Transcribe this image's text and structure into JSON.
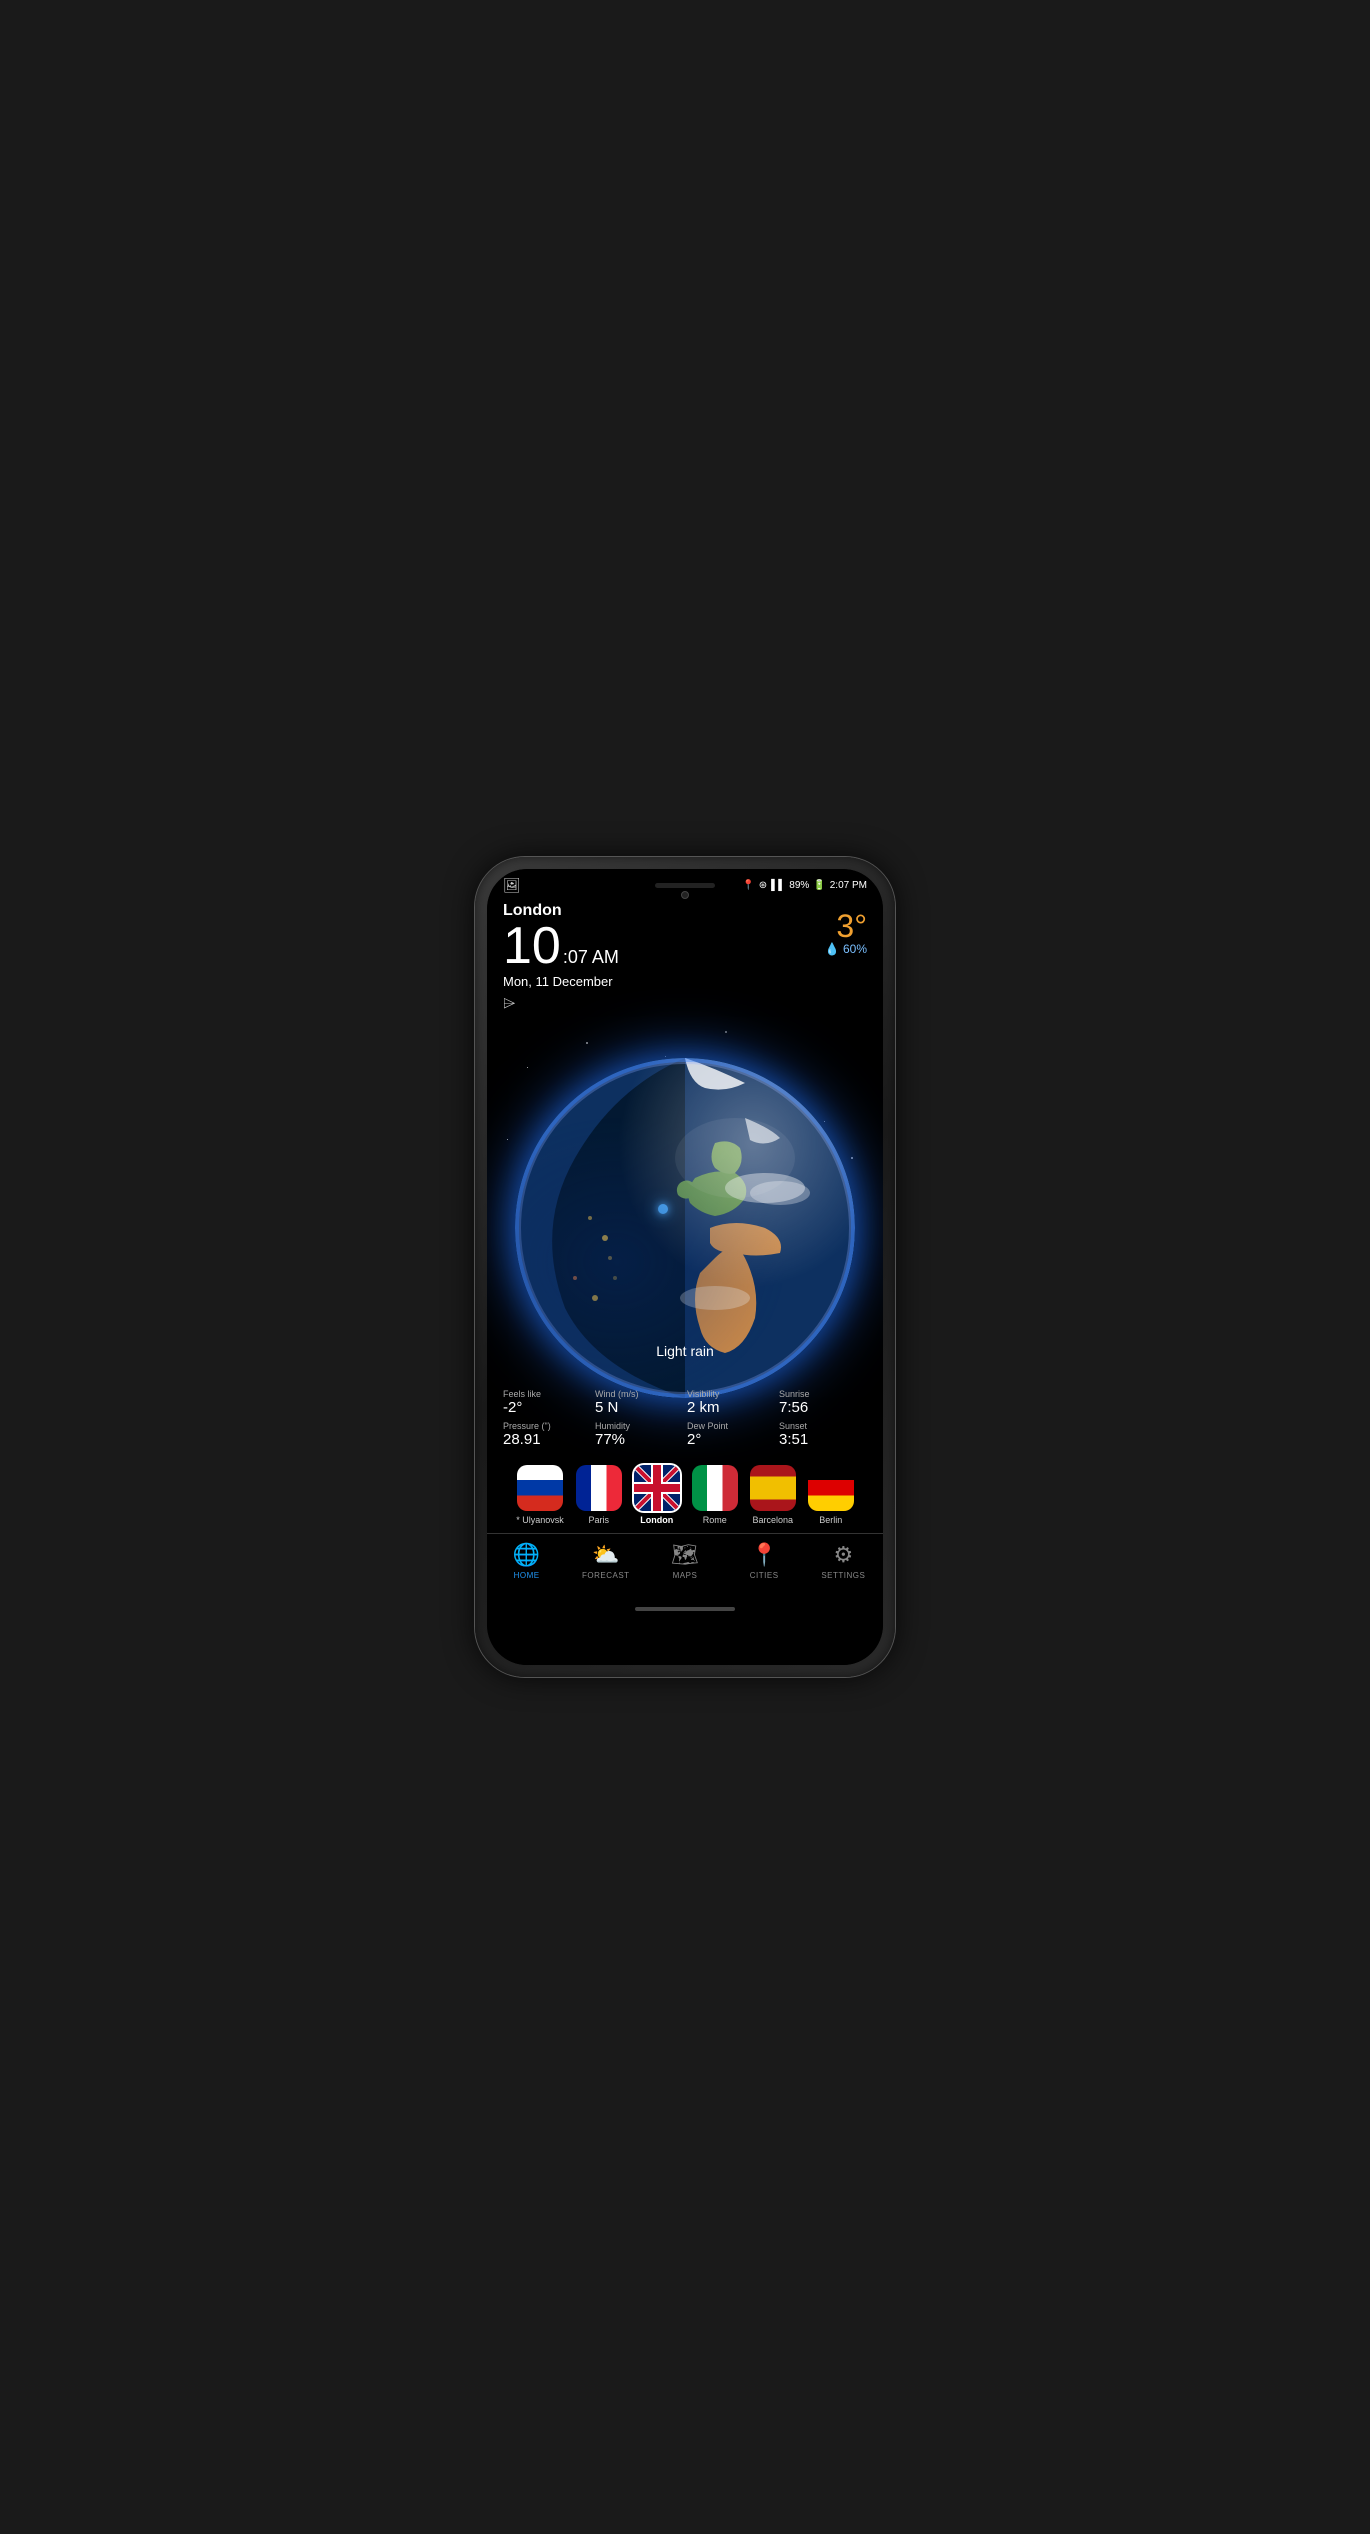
{
  "phone": {
    "status_bar": {
      "battery_percent": "89%",
      "time": "2:07 PM",
      "signal_icons": "📍 ⊛ ▌▌"
    },
    "header": {
      "city": "London",
      "time_big": "10",
      "time_small": ":07 AM",
      "date": "Mon, 11 December"
    },
    "weather_top": {
      "temperature": "3°",
      "rain_chance": "💧 60%"
    },
    "earth": {
      "condition": "Light rain"
    },
    "weather_details": [
      {
        "label": "Feels like",
        "value": "-2°"
      },
      {
        "label": "Wind (m/s)",
        "value": "5 N"
      },
      {
        "label": "Visibility",
        "value": "2 km"
      },
      {
        "label": "Sunrise",
        "value": "7:56"
      },
      {
        "label": "Pressure (\")",
        "value": "28.91"
      },
      {
        "label": "Humidity",
        "value": "77%"
      },
      {
        "label": "Dew Point",
        "value": "2°"
      },
      {
        "label": "Sunset",
        "value": "3:51"
      }
    ],
    "cities": [
      {
        "name": "* Ulyanovsk",
        "flag": "russia",
        "selected": false
      },
      {
        "name": "Paris",
        "flag": "france",
        "selected": false
      },
      {
        "name": "London",
        "flag": "uk",
        "selected": true
      },
      {
        "name": "Rome",
        "flag": "italy",
        "selected": false
      },
      {
        "name": "Barcelona",
        "flag": "spain",
        "selected": false
      },
      {
        "name": "Berlin",
        "flag": "germany",
        "selected": false
      }
    ],
    "nav": [
      {
        "label": "HOME",
        "icon": "🌐",
        "active": true
      },
      {
        "label": "FORECAST",
        "icon": "⛅",
        "active": false
      },
      {
        "label": "MAPS",
        "icon": "🗺",
        "active": false
      },
      {
        "label": "CITIES",
        "icon": "📍",
        "active": false
      },
      {
        "label": "SETTINGS",
        "icon": "⚙",
        "active": false
      }
    ]
  }
}
